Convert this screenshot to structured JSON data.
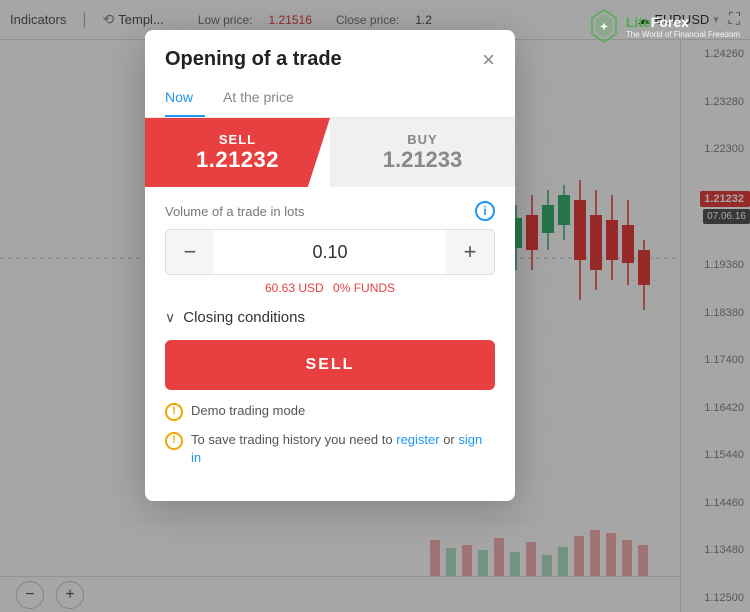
{
  "chart": {
    "background_color": "#f5f5f5",
    "pair": "EURUSD",
    "low_price": "1.21516",
    "close_price": "1.2",
    "price_ticks": [
      "1.24260",
      "1.23280",
      "1.22300",
      "1.21232",
      "1.19360",
      "1.18380",
      "1.17400",
      "1.16420",
      "1.15440",
      "1.14460",
      "1.13480",
      "1.12500"
    ],
    "current_price": "1.21232",
    "date_tag": "07.06.16"
  },
  "toolbar": {
    "indicators_label": "Indicators",
    "templates_label": "Templ...",
    "low_price_label": "Low price:",
    "low_price_value": "1.21516",
    "close_price_label": "Close price:",
    "close_price_value": "1.2",
    "pair_label": "EURUSD",
    "expand_icon": "⛶"
  },
  "bottom_toolbar": {
    "minus_label": "−",
    "plus_label": "+"
  },
  "modal": {
    "title": "Opening of a trade",
    "close_icon": "×",
    "tabs": [
      {
        "label": "Now",
        "active": true
      },
      {
        "label": "At the price",
        "active": false
      }
    ],
    "sell_label": "SELL",
    "sell_price": "1.21232",
    "buy_label": "BUY",
    "buy_price": "1.21233",
    "volume_label": "Volume of a trade in lots",
    "volume_value": "0.10",
    "volume_usd": "60.63 USD",
    "volume_funds_label": "0% FUNDS",
    "closing_conditions_label": "Closing conditions",
    "sell_action_label": "SELL",
    "notices": [
      {
        "id": "demo-mode",
        "text": "Demo trading mode"
      },
      {
        "id": "save-history",
        "text_before": "To save trading history you need to ",
        "link1_text": "register",
        "text_middle": " or ",
        "link2_text": "sign in"
      }
    ]
  },
  "liteforex": {
    "name": "LiteForex",
    "tagline": "The World of Financial Freedom"
  }
}
